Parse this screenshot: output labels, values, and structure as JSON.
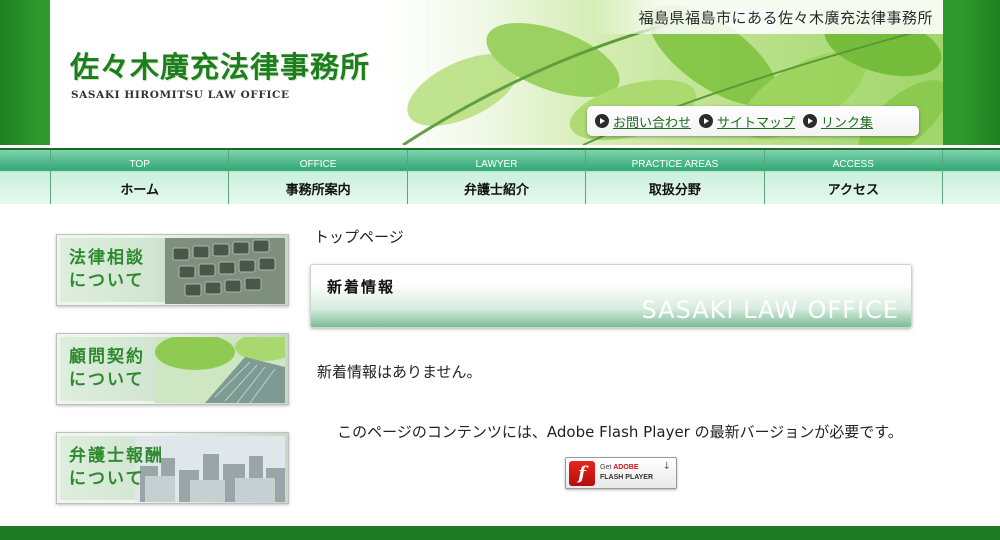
{
  "header": {
    "tagline": "福島県福島市にある佐々木廣充法律事務所",
    "logo_jp": "佐々木廣充法律事務所",
    "logo_en": "SASAKI HIROMITSU LAW OFFICE",
    "links": [
      {
        "label": "お問い合わせ",
        "icon": "play-bullet-icon"
      },
      {
        "label": "サイトマップ",
        "icon": "play-bullet-icon"
      },
      {
        "label": "リンク集",
        "icon": "play-bullet-icon"
      }
    ]
  },
  "nav": {
    "items": [
      {
        "en": "TOP",
        "jp": "ホーム"
      },
      {
        "en": "OFFICE",
        "jp": "事務所案内"
      },
      {
        "en": "LAWYER",
        "jp": "弁護士紹介"
      },
      {
        "en": "PRACTICE AREAS",
        "jp": "取扱分野"
      },
      {
        "en": "ACCESS",
        "jp": "アクセス"
      }
    ]
  },
  "sidebar": {
    "banners": [
      {
        "label": "法律相談\nについて",
        "image": "keyboard-image"
      },
      {
        "label": "顧問契約\nについて",
        "image": "office-building-image"
      },
      {
        "label": "弁護士報酬\nについて",
        "image": "cityscape-image"
      }
    ]
  },
  "main": {
    "breadcrumb": "トップページ",
    "news_title": "新着情報",
    "news_subtitle": "SASAKI LAW OFFICE",
    "no_news": "新着情報はありません。",
    "flash_message": "このページのコンテンツには、Adobe Flash Player の最新バージョンが必要です。",
    "flash_badge": {
      "get": "Get",
      "adobe": "ADOBE",
      "player": "FLASH PLAYER",
      "logo": "f"
    }
  },
  "colors": {
    "brand_green": "#1d7d1f",
    "nav_green": "#2fa772",
    "footer_green": "#1f7a26"
  }
}
